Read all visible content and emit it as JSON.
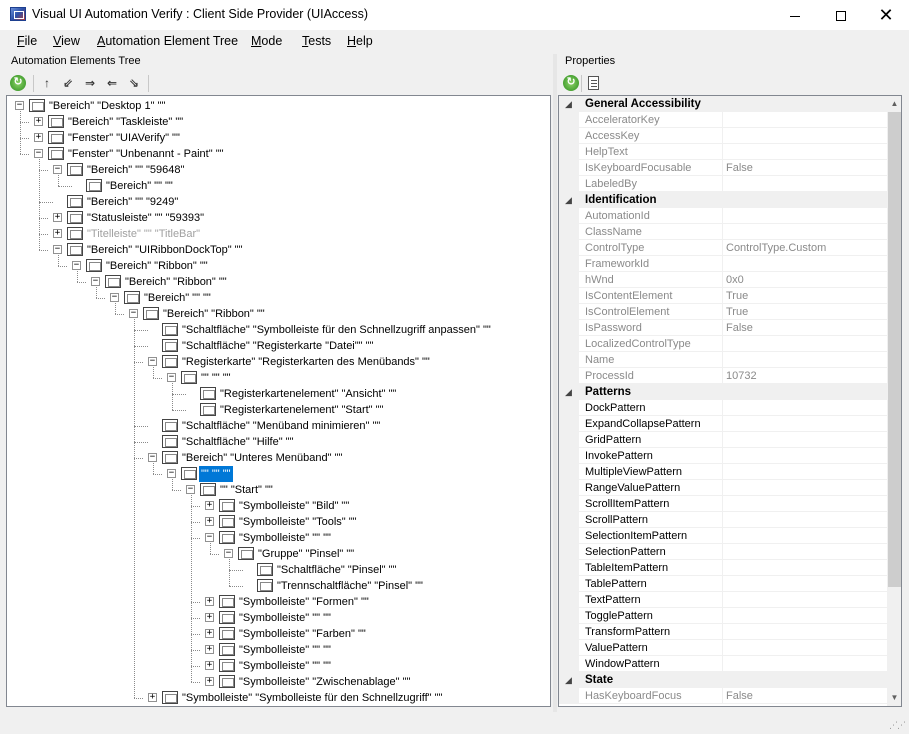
{
  "window": {
    "title": "Visual UI Automation Verify : Client Side Provider (UIAccess)",
    "controls": {
      "minimize": "minimize",
      "maximize": "maximize",
      "close": "✕"
    }
  },
  "menu": [
    "File",
    "View",
    "Automation Element Tree",
    "Mode",
    "Tests",
    "Help"
  ],
  "tree_pane": {
    "label": "Automation Elements Tree"
  },
  "properties_pane": {
    "label": "Properties"
  },
  "tree": [
    {
      "text": "\"Bereich\" \"Desktop 1\" \"\"",
      "depth": 0,
      "expander": "−",
      "state": "normal"
    },
    {
      "text": "\"Bereich\" \"Taskleiste\" \"\"",
      "depth": 1,
      "expander": "+",
      "state": "normal"
    },
    {
      "text": "\"Fenster\" \"UIAVerify\" \"\"",
      "depth": 1,
      "expander": "+",
      "state": "normal"
    },
    {
      "text": "\"Fenster\" \"Unbenannt - Paint\" \"\"",
      "depth": 1,
      "expander": "−",
      "state": "normal"
    },
    {
      "text": "\"Bereich\" \"\" \"59648\"",
      "depth": 2,
      "expander": "−",
      "state": "normal"
    },
    {
      "text": "\"Bereich\" \"\" \"\"",
      "depth": 3,
      "expander": "",
      "state": "normal"
    },
    {
      "text": "\"Bereich\" \"\" \"9249\"",
      "depth": 2,
      "expander": "",
      "state": "normal"
    },
    {
      "text": "\"Statusleiste\" \"\" \"59393\"",
      "depth": 2,
      "expander": "+",
      "state": "normal"
    },
    {
      "text": "\"Titelleiste\" \"\" \"TitleBar\"",
      "depth": 2,
      "expander": "+",
      "state": "disabled"
    },
    {
      "text": "\"Bereich\" \"UIRibbonDockTop\" \"\"",
      "depth": 2,
      "expander": "−",
      "state": "normal"
    },
    {
      "text": "\"Bereich\" \"Ribbon\" \"\"",
      "depth": 3,
      "expander": "−",
      "state": "normal"
    },
    {
      "text": "\"Bereich\" \"Ribbon\" \"\"",
      "depth": 4,
      "expander": "−",
      "state": "normal"
    },
    {
      "text": "\"Bereich\" \"\" \"\"",
      "depth": 5,
      "expander": "−",
      "state": "normal"
    },
    {
      "text": "\"Bereich\" \"Ribbon\" \"\"",
      "depth": 6,
      "expander": "−",
      "state": "normal"
    },
    {
      "text": "\"Schaltfläche\" \"Symbolleiste für den Schnellzugriff anpassen\" \"\"",
      "depth": 7,
      "expander": "",
      "state": "normal"
    },
    {
      "text": "\"Schaltfläche\" \"Registerkarte \"Datei\"\" \"\"",
      "depth": 7,
      "expander": "",
      "state": "normal"
    },
    {
      "text": "\"Registerkarte\" \"Registerkarten des Menübands\" \"\"",
      "depth": 7,
      "expander": "−",
      "state": "normal"
    },
    {
      "text": "\"\" \"\" \"\"",
      "depth": 8,
      "expander": "−",
      "state": "normal"
    },
    {
      "text": "\"Registerkartenelement\" \"Ansicht\" \"\"",
      "depth": 9,
      "expander": "",
      "state": "normal"
    },
    {
      "text": "\"Registerkartenelement\" \"Start\" \"\"",
      "depth": 9,
      "expander": "",
      "state": "normal"
    },
    {
      "text": "\"Schaltfläche\" \"Menüband minimieren\" \"\"",
      "depth": 7,
      "expander": "",
      "state": "normal"
    },
    {
      "text": "\"Schaltfläche\" \"Hilfe\" \"\"",
      "depth": 7,
      "expander": "",
      "state": "normal"
    },
    {
      "text": "\"Bereich\" \"Unteres Menüband\" \"\"",
      "depth": 7,
      "expander": "−",
      "state": "normal"
    },
    {
      "text": "\"\" \"\" \"\"",
      "depth": 8,
      "expander": "−",
      "state": "selected"
    },
    {
      "text": "\"\" \"Start\" \"\"",
      "depth": 9,
      "expander": "−",
      "state": "normal"
    },
    {
      "text": "\"Symbolleiste\" \"Bild\" \"\"",
      "depth": 10,
      "expander": "+",
      "state": "normal"
    },
    {
      "text": "\"Symbolleiste\" \"Tools\" \"\"",
      "depth": 10,
      "expander": "+",
      "state": "normal"
    },
    {
      "text": "\"Symbolleiste\" \"\" \"\"",
      "depth": 10,
      "expander": "−",
      "state": "normal"
    },
    {
      "text": "\"Gruppe\" \"Pinsel\" \"\"",
      "depth": 11,
      "expander": "−",
      "state": "normal"
    },
    {
      "text": "\"Schaltfläche\" \"Pinsel\" \"\"",
      "depth": 12,
      "expander": "",
      "state": "normal"
    },
    {
      "text": "\"Trennschaltfläche\" \"Pinsel\" \"\"",
      "depth": 12,
      "expander": "",
      "state": "normal"
    },
    {
      "text": "\"Symbolleiste\" \"Formen\" \"\"",
      "depth": 10,
      "expander": "+",
      "state": "normal"
    },
    {
      "text": "\"Symbolleiste\" \"\" \"\"",
      "depth": 10,
      "expander": "+",
      "state": "normal"
    },
    {
      "text": "\"Symbolleiste\" \"Farben\" \"\"",
      "depth": 10,
      "expander": "+",
      "state": "normal"
    },
    {
      "text": "\"Symbolleiste\" \"\" \"\"",
      "depth": 10,
      "expander": "+",
      "state": "normal"
    },
    {
      "text": "\"Symbolleiste\" \"\" \"\"",
      "depth": 10,
      "expander": "+",
      "state": "normal"
    },
    {
      "text": "\"Symbolleiste\" \"Zwischenablage\" \"\"",
      "depth": 10,
      "expander": "+",
      "state": "normal"
    },
    {
      "text": "\"Symbolleiste\" \"Symbolleiste für den Schnellzugriff\" \"\"",
      "depth": 7,
      "expander": "+",
      "state": "normal"
    }
  ],
  "properties": [
    {
      "category": "General Accessibility",
      "toggle": "◢",
      "items": [
        {
          "name": "AcceleratorKey",
          "value": ""
        },
        {
          "name": "AccessKey",
          "value": ""
        },
        {
          "name": "HelpText",
          "value": ""
        },
        {
          "name": "IsKeyboardFocusable",
          "value": "False"
        },
        {
          "name": "LabeledBy",
          "value": ""
        }
      ]
    },
    {
      "category": "Identification",
      "toggle": "◢",
      "items": [
        {
          "name": "AutomationId",
          "value": ""
        },
        {
          "name": "ClassName",
          "value": ""
        },
        {
          "name": "ControlType",
          "value": "ControlType.Custom"
        },
        {
          "name": "FrameworkId",
          "value": ""
        },
        {
          "name": "hWnd",
          "value": "0x0"
        },
        {
          "name": "IsContentElement",
          "value": "True"
        },
        {
          "name": "IsControlElement",
          "value": "True"
        },
        {
          "name": "IsPassword",
          "value": "False"
        },
        {
          "name": "LocalizedControlType",
          "value": ""
        },
        {
          "name": "Name",
          "value": ""
        },
        {
          "name": "ProcessId",
          "value": "10732"
        }
      ]
    },
    {
      "category": "Patterns",
      "toggle": "◢",
      "items": [
        {
          "name": "DockPattern",
          "value": ""
        },
        {
          "name": "ExpandCollapsePattern",
          "value": ""
        },
        {
          "name": "GridPattern",
          "value": ""
        },
        {
          "name": "InvokePattern",
          "value": ""
        },
        {
          "name": "MultipleViewPattern",
          "value": ""
        },
        {
          "name": "RangeValuePattern",
          "value": ""
        },
        {
          "name": "ScrollItemPattern",
          "value": ""
        },
        {
          "name": "ScrollPattern",
          "value": ""
        },
        {
          "name": "SelectionItemPattern",
          "value": ""
        },
        {
          "name": "SelectionPattern",
          "value": ""
        },
        {
          "name": "TableItemPattern",
          "value": ""
        },
        {
          "name": "TablePattern",
          "value": ""
        },
        {
          "name": "TextPattern",
          "value": ""
        },
        {
          "name": "TogglePattern",
          "value": ""
        },
        {
          "name": "TransformPattern",
          "value": ""
        },
        {
          "name": "ValuePattern",
          "value": ""
        },
        {
          "name": "WindowPattern",
          "value": ""
        }
      ]
    },
    {
      "category": "State",
      "toggle": "◢",
      "items": [
        {
          "name": "HasKeyboardFocus",
          "value": "False"
        }
      ]
    }
  ],
  "pattern_categories": [
    "Patterns"
  ],
  "colors": {
    "selection": "#0078d7",
    "disabled_text": "#a0a0a0",
    "category_bg": "#f0f0f0"
  }
}
